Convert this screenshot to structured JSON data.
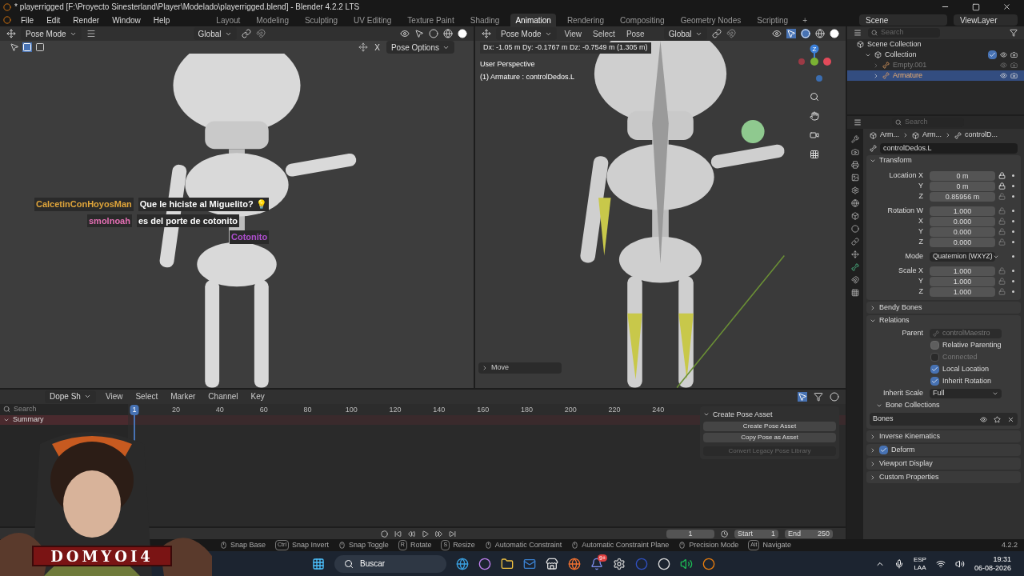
{
  "window": {
    "title": "* playerrigged [F:\\Proyecto Sinesterland\\Player\\Modelado\\playerrigged.blend] - Blender 4.2.2 LTS"
  },
  "menu": [
    "File",
    "Edit",
    "Render",
    "Window",
    "Help"
  ],
  "workspaces": [
    {
      "label": "Layout",
      "selected": false
    },
    {
      "label": "Modeling",
      "selected": false
    },
    {
      "label": "Sculpting",
      "selected": false
    },
    {
      "label": "UV Editing",
      "selected": false
    },
    {
      "label": "Texture Paint",
      "selected": false
    },
    {
      "label": "Shading",
      "selected": false
    },
    {
      "label": "Animation",
      "selected": true
    },
    {
      "label": "Rendering",
      "selected": false
    },
    {
      "label": "Compositing",
      "selected": false
    },
    {
      "label": "Geometry Nodes",
      "selected": false
    },
    {
      "label": "Scripting",
      "selected": false
    }
  ],
  "add_workspace": "+",
  "scene": "Scene",
  "view_layer": "ViewLayer",
  "left_viewport": {
    "mode": "Pose Mode",
    "orientation": "Global",
    "mirror_x": "X",
    "pose_options": "Pose Options"
  },
  "chat": [
    {
      "user": "CalcetinConHoyosMan",
      "message": "Que le hiciste al Miguelito? 💡",
      "color": "#e0a53a"
    },
    {
      "user": "smolnoah",
      "message": "es del porte de cotonito",
      "color": "#e46fb4"
    },
    {
      "user": "Cotonito",
      "color": "#b04fd0"
    }
  ],
  "right_viewport": {
    "mode": "Pose Mode",
    "menus": [
      "View",
      "Select",
      "Pose"
    ],
    "orientation": "Global",
    "delta": "Dx: -1.05 m   Dy: -0.1767 m   Dz: -0.7549 m (1.305 m)",
    "perspective": "User Perspective",
    "active": "(1) Armature : controlDedos.L",
    "axis_label": "Z",
    "operator": "Move"
  },
  "outliner": {
    "search": {
      "placeholder": "Search"
    },
    "items": [
      {
        "label": "Scene Collection",
        "children": [
          {
            "label": "Collection",
            "expanded": true,
            "checked": true,
            "children": [
              {
                "label": "Empty.001",
                "selected": false,
                "hidden": true
              },
              {
                "label": "Armature",
                "selected": true,
                "hidden": false
              }
            ]
          }
        ]
      }
    ]
  },
  "properties": {
    "search": {
      "placeholder": "Search"
    },
    "breadcrumb": [
      "Arm...",
      "Arm...",
      "controlD..."
    ],
    "bone_name": "controlDedos.L",
    "transform": {
      "title": "Transform",
      "expanded": true,
      "groups": [
        [
          {
            "label": "Location X",
            "value": "0 m",
            "locked": true,
            "kind": "number"
          },
          {
            "label": "Y",
            "value": "0 m",
            "locked": true,
            "kind": "number"
          },
          {
            "label": "Z",
            "value": "0.85956 m",
            "locked": false,
            "kind": "number"
          }
        ],
        [
          {
            "label": "Rotation W",
            "value": "1.000",
            "locked": false,
            "kind": "number"
          },
          {
            "label": "X",
            "value": "0.000",
            "locked": false,
            "kind": "number"
          },
          {
            "label": "Y",
            "value": "0.000",
            "locked": false,
            "kind": "number"
          },
          {
            "label": "Z",
            "value": "0.000",
            "locked": false,
            "kind": "number"
          }
        ],
        [
          {
            "label": "Mode",
            "value": "Quaternion (WXYZ)",
            "kind": "dropdown"
          }
        ],
        [
          {
            "label": "Scale X",
            "value": "1.000",
            "locked": false,
            "kind": "number"
          },
          {
            "label": "Y",
            "value": "1.000",
            "locked": false,
            "kind": "number"
          },
          {
            "label": "Z",
            "value": "1.000",
            "locked": false,
            "kind": "number"
          }
        ]
      ]
    },
    "bendy": {
      "title": "Bendy Bones",
      "expanded": false
    },
    "relations": {
      "title": "Relations",
      "expanded": true,
      "parent_label": "Parent",
      "parent": "controlMaestro",
      "checks": [
        {
          "label": "Relative Parenting",
          "checked": false,
          "disabled": false
        },
        {
          "label": "Connected",
          "checked": false,
          "disabled": true
        },
        {
          "label": "Local Location",
          "checked": true,
          "disabled": false
        },
        {
          "label": "Inherit Rotation",
          "checked": true,
          "disabled": false
        }
      ],
      "inherit_scale_label": "Inherit Scale",
      "inherit_scale": "Full",
      "collections_title": "Bone Collections",
      "collections_expanded": true,
      "collections": [
        "Bones"
      ]
    },
    "panels": [
      {
        "title": "Inverse Kinematics",
        "expanded": false
      },
      {
        "title": "Deform",
        "expanded": false,
        "checked": true
      },
      {
        "title": "Viewport Display",
        "expanded": false
      },
      {
        "title": "Custom Properties",
        "expanded": false
      }
    ]
  },
  "dopesheet": {
    "editor": "Dope Sh",
    "menus": [
      "View",
      "Select",
      "Marker",
      "Channel",
      "Key"
    ],
    "search": {
      "placeholder": "Search"
    },
    "channel": "Summary",
    "frames": [
      "1",
      "20",
      "40",
      "60",
      "80",
      "100",
      "120",
      "140",
      "160",
      "180",
      "200",
      "220",
      "240"
    ]
  },
  "pose_asset": {
    "title": "Create Pose Asset",
    "expanded": true,
    "buttons": [
      {
        "label": "Create Pose Asset",
        "disabled": false
      },
      {
        "label": "Copy Pose as Asset",
        "disabled": false
      },
      {
        "label": "Convert Legacy Pose Library",
        "disabled": true
      }
    ]
  },
  "playback": {
    "current": "1",
    "start_label": "Start",
    "start": "1",
    "end_label": "End",
    "end": "250"
  },
  "status": {
    "items": [
      {
        "label": "Snap Base"
      },
      {
        "key": "Ctrl",
        "label": "Snap Invert"
      },
      {
        "label": "Snap Toggle"
      },
      {
        "key": "R",
        "label": "Rotate"
      },
      {
        "key": "S",
        "label": "Resize"
      },
      {
        "label": "Automatic Constraint"
      },
      {
        "label": "Automatic Constraint Plane"
      },
      {
        "label": "Precision Mode"
      },
      {
        "key": "Alt",
        "label": "Navigate"
      }
    ],
    "version": "4.2.2"
  },
  "webcam": {
    "banner": "DOMYOI4"
  },
  "taskbar": {
    "search": "Buscar",
    "badge": "9+",
    "language": "ESP",
    "layout": "LAA",
    "time": "19:31",
    "date": "06-08-2026"
  }
}
